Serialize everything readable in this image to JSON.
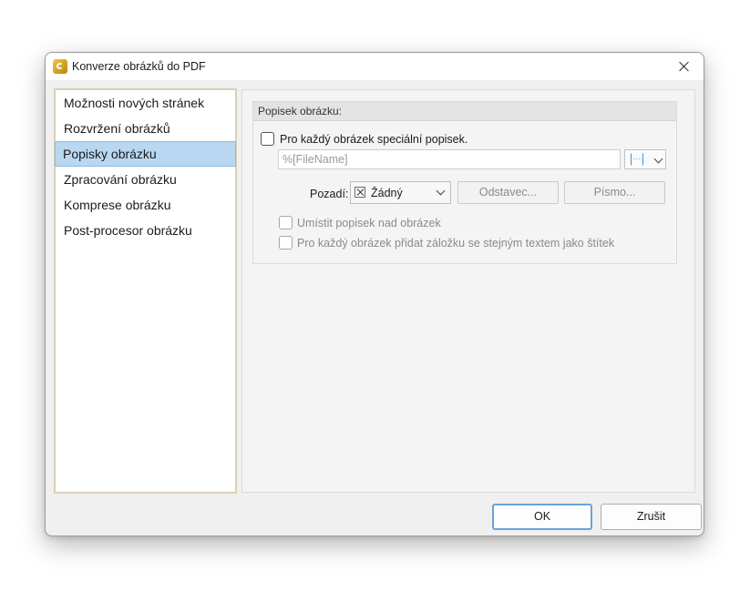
{
  "window": {
    "title": "Konverze obrázků do PDF"
  },
  "nav": {
    "items": [
      {
        "label": "Možnosti nových stránek"
      },
      {
        "label": "Rozvržení obrázků"
      },
      {
        "label": "Popisky obrázku",
        "selected": true
      },
      {
        "label": "Zpracování obrázku"
      },
      {
        "label": "Komprese obrázku"
      },
      {
        "label": "Post-procesor obrázku"
      }
    ]
  },
  "caption_group": {
    "header": "Popisek obrázku:",
    "special_caption_label": "Pro každý obrázek speciální popisek.",
    "special_caption_checked": false,
    "text_field_placeholder": "%[FileName]",
    "macro_button_glyph": "[...]",
    "background_label": "Pozadí:",
    "background_value": "Žádný",
    "paragraph_button": "Odstavec...",
    "font_button": "Písmo...",
    "place_above_label": "Umístit popisek nad obrázek",
    "bookmark_label": "Pro každý obrázek přidat záložku se stejným textem jako štítek"
  },
  "footer": {
    "ok_label": "OK",
    "cancel_label": "Zrušit"
  },
  "colors": {
    "selection": "#b9d7f0",
    "default_button_border": "#6aa3d6",
    "macro_icon": "#4a90d9"
  }
}
